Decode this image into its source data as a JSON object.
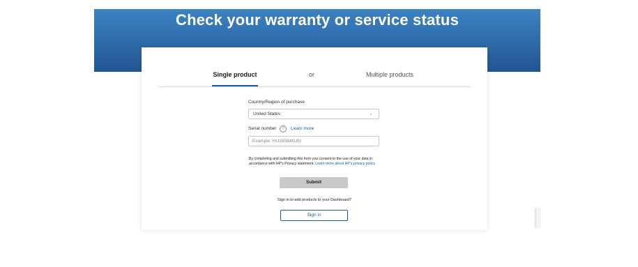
{
  "hero": {
    "title": "Check your warranty or service status"
  },
  "tabs": {
    "single": "Single product",
    "or": "or",
    "multiple": "Multiple products"
  },
  "country": {
    "label": "Country/Region of purchase",
    "value": "United States"
  },
  "serial": {
    "label": "Serial number",
    "help": "?",
    "learn_more": "Learn more",
    "placeholder": "Example: HU265BM18V"
  },
  "consent": {
    "text": "By completing and submitting this form you consent to the use of your data in accordance with HP's Privacy statement.",
    "link": "Learn more about HP's privacy policy"
  },
  "submit": {
    "label": "Submit"
  },
  "signin": {
    "prompt": "Sign in to add products to your Dashboard?",
    "button": "Sign in"
  },
  "colors": {
    "hero_top": "#3b82c4",
    "hero_bottom": "#1f5590",
    "accent": "#0e5fa8",
    "submit_bg": "#c9c9c9"
  },
  "icons": {
    "dropdown": "chevron-down-icon",
    "help": "help-circle-icon"
  }
}
